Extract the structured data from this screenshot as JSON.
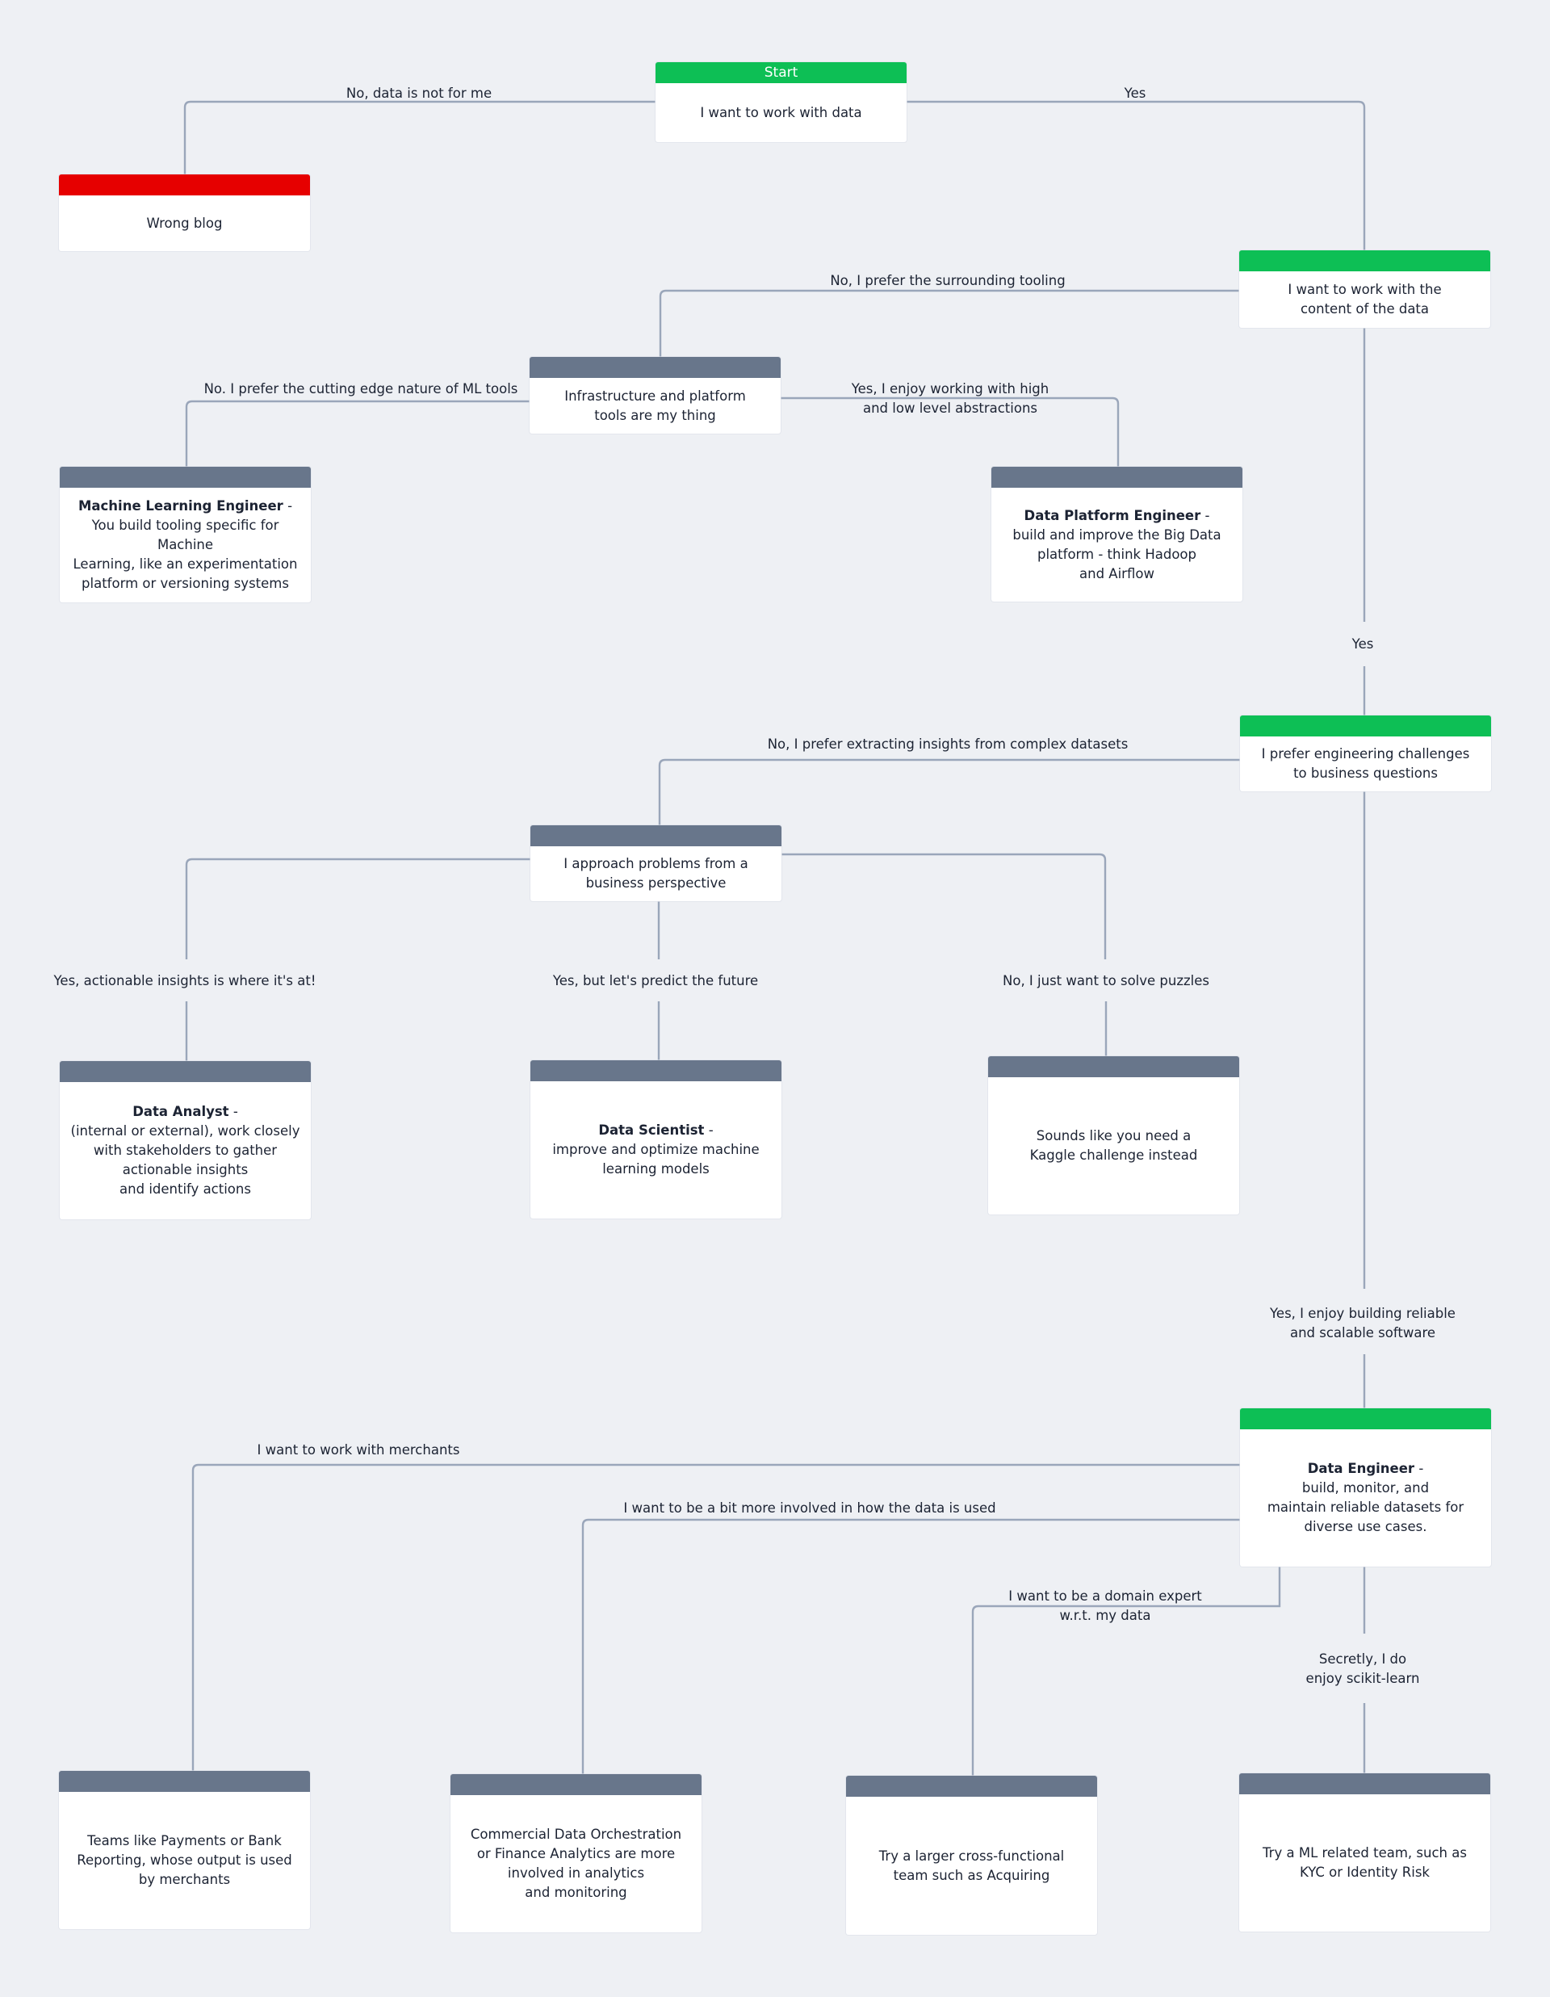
{
  "colors": {
    "background": "#eef0f4",
    "connector": "#9aa6ba",
    "header_green": "#0dbf55",
    "header_red": "#e60000",
    "header_gray": "#68768b",
    "text": "#1c2333"
  },
  "nodes": {
    "start": {
      "header": "Start",
      "text": "I want to work with data",
      "kind": "green"
    },
    "wrong_blog": {
      "header": "",
      "text": "Wrong blog",
      "kind": "red"
    },
    "content": {
      "header": "",
      "text": "I want to work with the\ncontent of the data",
      "kind": "green"
    },
    "infra": {
      "header": "",
      "text": "Infrastructure and platform\ntools are my thing",
      "kind": "gray"
    },
    "mle": {
      "header": "",
      "title": "Machine Learning Engineer",
      "text": "You build tooling specific for Machine\nLearning, like an experimentation\nplatform or versioning systems",
      "kind": "gray"
    },
    "dpe": {
      "header": "",
      "title": "Data Platform Engineer",
      "text": "build and improve the Big Data\nplatform - think Hadoop\nand Airflow",
      "kind": "gray"
    },
    "engineering": {
      "header": "",
      "text": "I prefer engineering challenges\nto business questions",
      "kind": "green"
    },
    "business": {
      "header": "",
      "text": "I approach problems from a\nbusiness perspective",
      "kind": "gray"
    },
    "analyst": {
      "header": "",
      "title": "Data Analyst",
      "text": "(internal or external), work closely\nwith stakeholders to gather\nactionable insights\nand identify actions",
      "kind": "gray"
    },
    "scientist": {
      "header": "",
      "title": "Data Scientist",
      "text": "improve and optimize machine\nlearning models",
      "kind": "gray"
    },
    "kaggle": {
      "header": "",
      "text": "Sounds like you need a\nKaggle challenge instead",
      "kind": "gray"
    },
    "data_engineer": {
      "header": "",
      "title": "Data Engineer",
      "text": "build, monitor, and\nmaintain reliable datasets for\ndiverse use cases.",
      "kind": "green"
    },
    "merchants": {
      "header": "",
      "text": "Teams like Payments or Bank\nReporting, whose output is used\nby merchants",
      "kind": "gray"
    },
    "commercial": {
      "header": "",
      "text": "Commercial Data Orchestration\nor Finance Analytics are more\ninvolved in analytics\nand monitoring",
      "kind": "gray"
    },
    "acquiring": {
      "header": "",
      "text": "Try a larger cross-functional\nteam such as Acquiring",
      "kind": "gray"
    },
    "ml_team": {
      "header": "",
      "text": "Try a ML related team, such as\nKYC or Identity Risk",
      "kind": "gray"
    }
  },
  "edges": {
    "no_data": "No, data is not for me",
    "yes_data": "Yes",
    "surrounding_tooling": "No, I prefer the surrounding tooling",
    "cutting_edge_ml": "No. I prefer the cutting edge nature of  ML tools",
    "high_low_abstractions": "Yes, I enjoy working with high\nand low level abstractions",
    "yes_content": "Yes",
    "extracting_insights": "No, I prefer extracting insights from complex datasets",
    "actionable_insights": "Yes, actionable insights is where it's at!",
    "predict_future": "Yes, but let's predict the future",
    "solve_puzzles": "No, I just want to solve puzzles",
    "reliable_software": "Yes, I  enjoy building reliable\nand scalable software",
    "work_with_merchants": "I want to work with merchants",
    "more_involved": "I want to be a bit more involved in how the data is used",
    "domain_expert": "I want to be a domain expert\nw.r.t. my data",
    "scikit_learn": "Secretly, I do\nenjoy scikit-learn"
  }
}
